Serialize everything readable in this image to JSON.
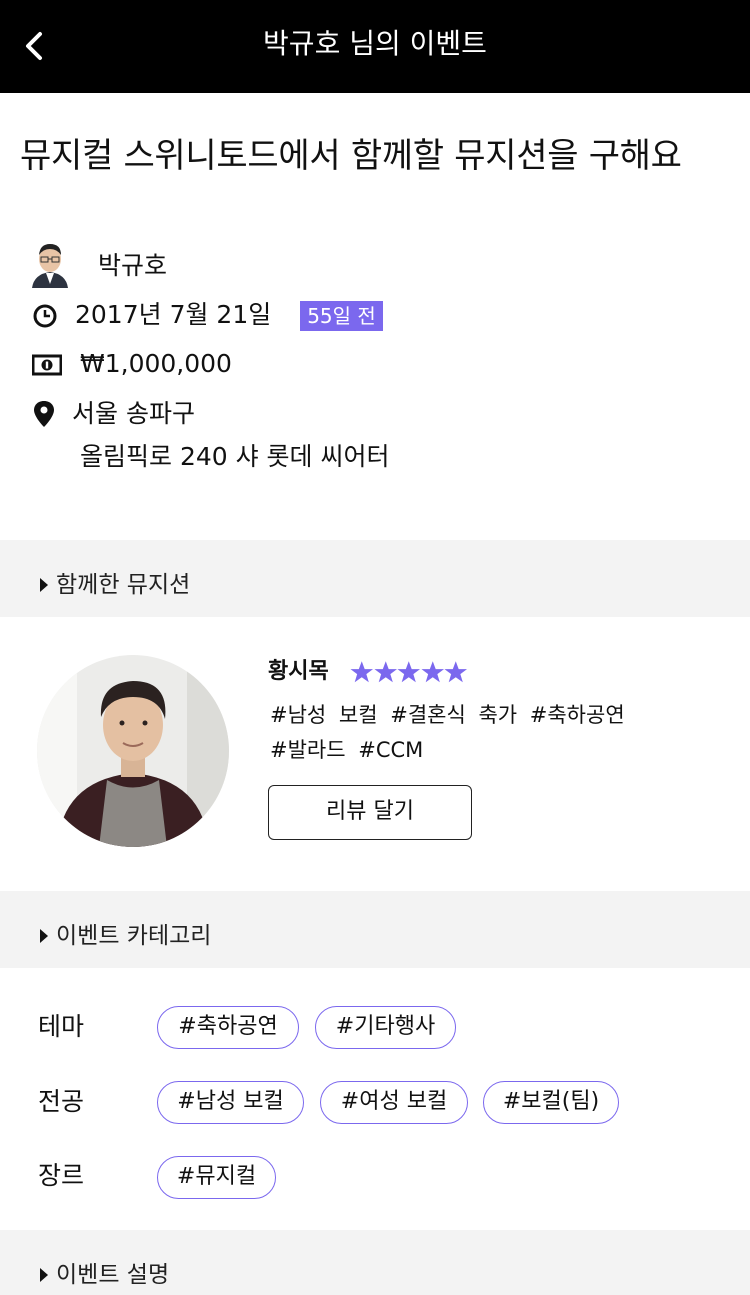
{
  "header": {
    "title": "박규호 님의 이벤트",
    "back_icon": "chevron-left-icon"
  },
  "event": {
    "title": "뮤지컬 스위니토드에서 함께할 뮤지션을 구해요",
    "host_name": "박규호",
    "date": "2017년 7월 21일",
    "dday": "55일 전",
    "price": "₩1,000,000",
    "location_line1": "서울 송파구",
    "location_line2": "올림픽로 240 샤 롯데 씨어터"
  },
  "sections": {
    "musicians": "함께한 뮤지션",
    "category": "이벤트 카테고리",
    "description": "이벤트 설명"
  },
  "musician": {
    "name": "황시목",
    "rating": 5,
    "tags_line1": "#남성 보컬 #결혼식 축가 #축하공연",
    "tags_line2": "#발라드 #CCM",
    "review_button": "리뷰 달기"
  },
  "categories": {
    "theme_label": "테마",
    "theme_tags": [
      "#축하공연",
      "#기타행사"
    ],
    "major_label": "전공",
    "major_tags": [
      "#남성 보컬",
      "#여성 보컬",
      "#보컬(팀)"
    ],
    "genre_label": "장르",
    "genre_tags": [
      "#뮤지컬"
    ]
  },
  "colors": {
    "accent": "#7b68ee",
    "header_bg": "#000000",
    "section_bg": "#f3f3f3"
  }
}
